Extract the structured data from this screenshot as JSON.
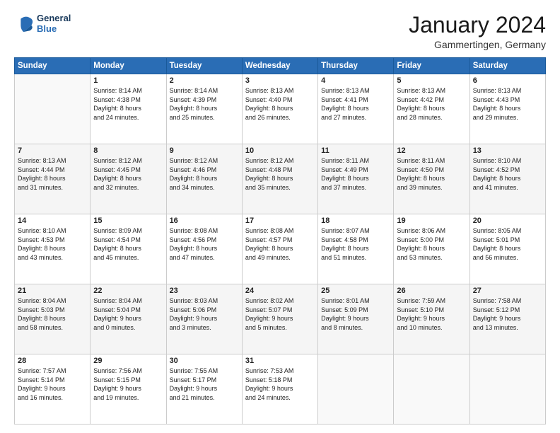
{
  "header": {
    "logo_line1": "General",
    "logo_line2": "Blue",
    "month": "January 2024",
    "location": "Gammertingen, Germany"
  },
  "weekdays": [
    "Sunday",
    "Monday",
    "Tuesday",
    "Wednesday",
    "Thursday",
    "Friday",
    "Saturday"
  ],
  "weeks": [
    [
      {
        "day": "",
        "text": ""
      },
      {
        "day": "1",
        "text": "Sunrise: 8:14 AM\nSunset: 4:38 PM\nDaylight: 8 hours\nand 24 minutes."
      },
      {
        "day": "2",
        "text": "Sunrise: 8:14 AM\nSunset: 4:39 PM\nDaylight: 8 hours\nand 25 minutes."
      },
      {
        "day": "3",
        "text": "Sunrise: 8:13 AM\nSunset: 4:40 PM\nDaylight: 8 hours\nand 26 minutes."
      },
      {
        "day": "4",
        "text": "Sunrise: 8:13 AM\nSunset: 4:41 PM\nDaylight: 8 hours\nand 27 minutes."
      },
      {
        "day": "5",
        "text": "Sunrise: 8:13 AM\nSunset: 4:42 PM\nDaylight: 8 hours\nand 28 minutes."
      },
      {
        "day": "6",
        "text": "Sunrise: 8:13 AM\nSunset: 4:43 PM\nDaylight: 8 hours\nand 29 minutes."
      }
    ],
    [
      {
        "day": "7",
        "text": "Sunrise: 8:13 AM\nSunset: 4:44 PM\nDaylight: 8 hours\nand 31 minutes."
      },
      {
        "day": "8",
        "text": "Sunrise: 8:12 AM\nSunset: 4:45 PM\nDaylight: 8 hours\nand 32 minutes."
      },
      {
        "day": "9",
        "text": "Sunrise: 8:12 AM\nSunset: 4:46 PM\nDaylight: 8 hours\nand 34 minutes."
      },
      {
        "day": "10",
        "text": "Sunrise: 8:12 AM\nSunset: 4:48 PM\nDaylight: 8 hours\nand 35 minutes."
      },
      {
        "day": "11",
        "text": "Sunrise: 8:11 AM\nSunset: 4:49 PM\nDaylight: 8 hours\nand 37 minutes."
      },
      {
        "day": "12",
        "text": "Sunrise: 8:11 AM\nSunset: 4:50 PM\nDaylight: 8 hours\nand 39 minutes."
      },
      {
        "day": "13",
        "text": "Sunrise: 8:10 AM\nSunset: 4:52 PM\nDaylight: 8 hours\nand 41 minutes."
      }
    ],
    [
      {
        "day": "14",
        "text": "Sunrise: 8:10 AM\nSunset: 4:53 PM\nDaylight: 8 hours\nand 43 minutes."
      },
      {
        "day": "15",
        "text": "Sunrise: 8:09 AM\nSunset: 4:54 PM\nDaylight: 8 hours\nand 45 minutes."
      },
      {
        "day": "16",
        "text": "Sunrise: 8:08 AM\nSunset: 4:56 PM\nDaylight: 8 hours\nand 47 minutes."
      },
      {
        "day": "17",
        "text": "Sunrise: 8:08 AM\nSunset: 4:57 PM\nDaylight: 8 hours\nand 49 minutes."
      },
      {
        "day": "18",
        "text": "Sunrise: 8:07 AM\nSunset: 4:58 PM\nDaylight: 8 hours\nand 51 minutes."
      },
      {
        "day": "19",
        "text": "Sunrise: 8:06 AM\nSunset: 5:00 PM\nDaylight: 8 hours\nand 53 minutes."
      },
      {
        "day": "20",
        "text": "Sunrise: 8:05 AM\nSunset: 5:01 PM\nDaylight: 8 hours\nand 56 minutes."
      }
    ],
    [
      {
        "day": "21",
        "text": "Sunrise: 8:04 AM\nSunset: 5:03 PM\nDaylight: 8 hours\nand 58 minutes."
      },
      {
        "day": "22",
        "text": "Sunrise: 8:04 AM\nSunset: 5:04 PM\nDaylight: 9 hours\nand 0 minutes."
      },
      {
        "day": "23",
        "text": "Sunrise: 8:03 AM\nSunset: 5:06 PM\nDaylight: 9 hours\nand 3 minutes."
      },
      {
        "day": "24",
        "text": "Sunrise: 8:02 AM\nSunset: 5:07 PM\nDaylight: 9 hours\nand 5 minutes."
      },
      {
        "day": "25",
        "text": "Sunrise: 8:01 AM\nSunset: 5:09 PM\nDaylight: 9 hours\nand 8 minutes."
      },
      {
        "day": "26",
        "text": "Sunrise: 7:59 AM\nSunset: 5:10 PM\nDaylight: 9 hours\nand 10 minutes."
      },
      {
        "day": "27",
        "text": "Sunrise: 7:58 AM\nSunset: 5:12 PM\nDaylight: 9 hours\nand 13 minutes."
      }
    ],
    [
      {
        "day": "28",
        "text": "Sunrise: 7:57 AM\nSunset: 5:14 PM\nDaylight: 9 hours\nand 16 minutes."
      },
      {
        "day": "29",
        "text": "Sunrise: 7:56 AM\nSunset: 5:15 PM\nDaylight: 9 hours\nand 19 minutes."
      },
      {
        "day": "30",
        "text": "Sunrise: 7:55 AM\nSunset: 5:17 PM\nDaylight: 9 hours\nand 21 minutes."
      },
      {
        "day": "31",
        "text": "Sunrise: 7:53 AM\nSunset: 5:18 PM\nDaylight: 9 hours\nand 24 minutes."
      },
      {
        "day": "",
        "text": ""
      },
      {
        "day": "",
        "text": ""
      },
      {
        "day": "",
        "text": ""
      }
    ]
  ]
}
